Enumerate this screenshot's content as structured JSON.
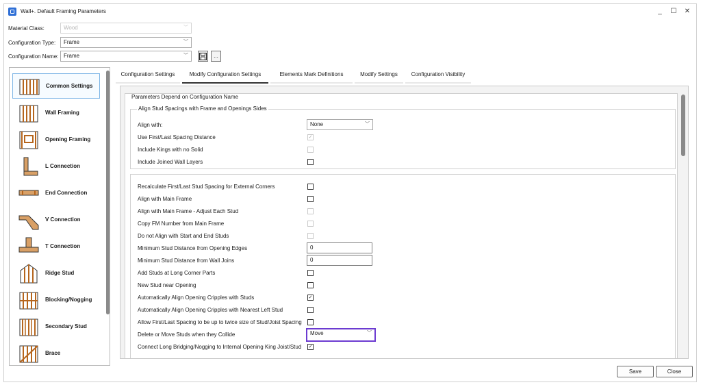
{
  "window": {
    "title": "Wall+. Default Framing Parameters",
    "controls": {
      "minimize": "_",
      "maximize": "☐",
      "close": "✕"
    }
  },
  "header": {
    "material_class": {
      "label": "Material Class:",
      "value": "Wood",
      "disabled": true
    },
    "configuration_type": {
      "label": "Configuration Type:",
      "value": "Frame"
    },
    "configuration_name": {
      "label": "Configuration Name:",
      "value": "Frame",
      "save_icon": "save-icon",
      "more_label": "..."
    }
  },
  "sidebar": {
    "items": [
      {
        "label": "Common Settings",
        "icon": "common-settings-icon",
        "selected": true
      },
      {
        "label": "Wall Framing",
        "icon": "wall-framing-icon"
      },
      {
        "label": "Opening Framing",
        "icon": "opening-framing-icon"
      },
      {
        "label": "L Connection",
        "icon": "l-connection-icon"
      },
      {
        "label": "End Connection",
        "icon": "end-connection-icon"
      },
      {
        "label": "V Connection",
        "icon": "v-connection-icon"
      },
      {
        "label": "T Connection",
        "icon": "t-connection-icon"
      },
      {
        "label": "Ridge Stud",
        "icon": "ridge-stud-icon"
      },
      {
        "label": "Blocking/Nogging",
        "icon": "blocking-nogging-icon"
      },
      {
        "label": "Secondary Stud",
        "icon": "secondary-stud-icon"
      },
      {
        "label": "Brace",
        "icon": "brace-icon"
      }
    ]
  },
  "tabs": [
    {
      "label": "Configuration Settings",
      "active": false
    },
    {
      "label": "Modify Configuration Settings",
      "active": true
    },
    {
      "label": "Elements Mark Definitions",
      "active": false
    },
    {
      "label": "Modify Settings",
      "active": false
    },
    {
      "label": "Configuration Visibility",
      "active": false
    }
  ],
  "panel": {
    "outer_title": "Parameters Depend on Configuration Name",
    "group1": {
      "title": "Align Stud Spacings with Frame and Openings Sides",
      "rows": [
        {
          "label": "Align with:",
          "type": "combo",
          "value": "None"
        },
        {
          "label": "Use First/Last Spacing Distance",
          "type": "checkbox",
          "checked": true,
          "disabled": true
        },
        {
          "label": "Include Kings with no Solid",
          "type": "checkbox",
          "checked": false,
          "disabled": true
        },
        {
          "label": "Include Joined Wall Layers",
          "type": "checkbox",
          "checked": false,
          "disabled": false
        }
      ]
    },
    "group2": {
      "rows": [
        {
          "label": "Recalculate First/Last Stud Spacing for External Corners",
          "type": "checkbox",
          "checked": false,
          "disabled": false
        },
        {
          "label": "Align with Main Frame",
          "type": "checkbox",
          "checked": false,
          "disabled": false
        },
        {
          "label": "Align with Main Frame - Adjust Each Stud",
          "type": "checkbox",
          "checked": false,
          "disabled": true
        },
        {
          "label": "Copy FM Number from Main Frame",
          "type": "checkbox",
          "checked": false,
          "disabled": true
        },
        {
          "label": "Do not Align with Start and End Studs",
          "type": "checkbox",
          "checked": false,
          "disabled": true
        },
        {
          "label": "Minimum Stud Distance from Opening Edges",
          "type": "text",
          "value": "0"
        },
        {
          "label": "Minimum Stud Distance from Wall Joins",
          "type": "text",
          "value": "0"
        },
        {
          "label": "Add Studs at Long Corner Parts",
          "type": "checkbox",
          "checked": false,
          "disabled": false
        },
        {
          "label": "New Stud near Opening",
          "type": "checkbox",
          "checked": false,
          "disabled": false
        },
        {
          "label": "Automatically Align Opening Cripples with Studs",
          "type": "checkbox",
          "checked": true,
          "disabled": false
        },
        {
          "label": "Automatically Align Opening Cripples with Nearest Left Stud",
          "type": "checkbox",
          "checked": false,
          "disabled": false
        },
        {
          "label": "Allow First/Last Spacing to be up to twice size of Stud/Joist Spacing",
          "type": "checkbox",
          "checked": false,
          "disabled": false
        },
        {
          "label": "Delete or Move Studs when they Collide",
          "type": "combo",
          "value": "Move",
          "highlighted": true
        },
        {
          "label": "Connect Long Bridging/Nogging to Internal Opening King Joist/Stud",
          "type": "checkbox",
          "checked": true,
          "disabled": false
        }
      ]
    }
  },
  "footer": {
    "save_label": "Save",
    "close_label": "Close"
  },
  "colors": {
    "highlight": "#6c3bd1",
    "selected_border": "#7fb6e6",
    "wood": "#b5651d"
  }
}
